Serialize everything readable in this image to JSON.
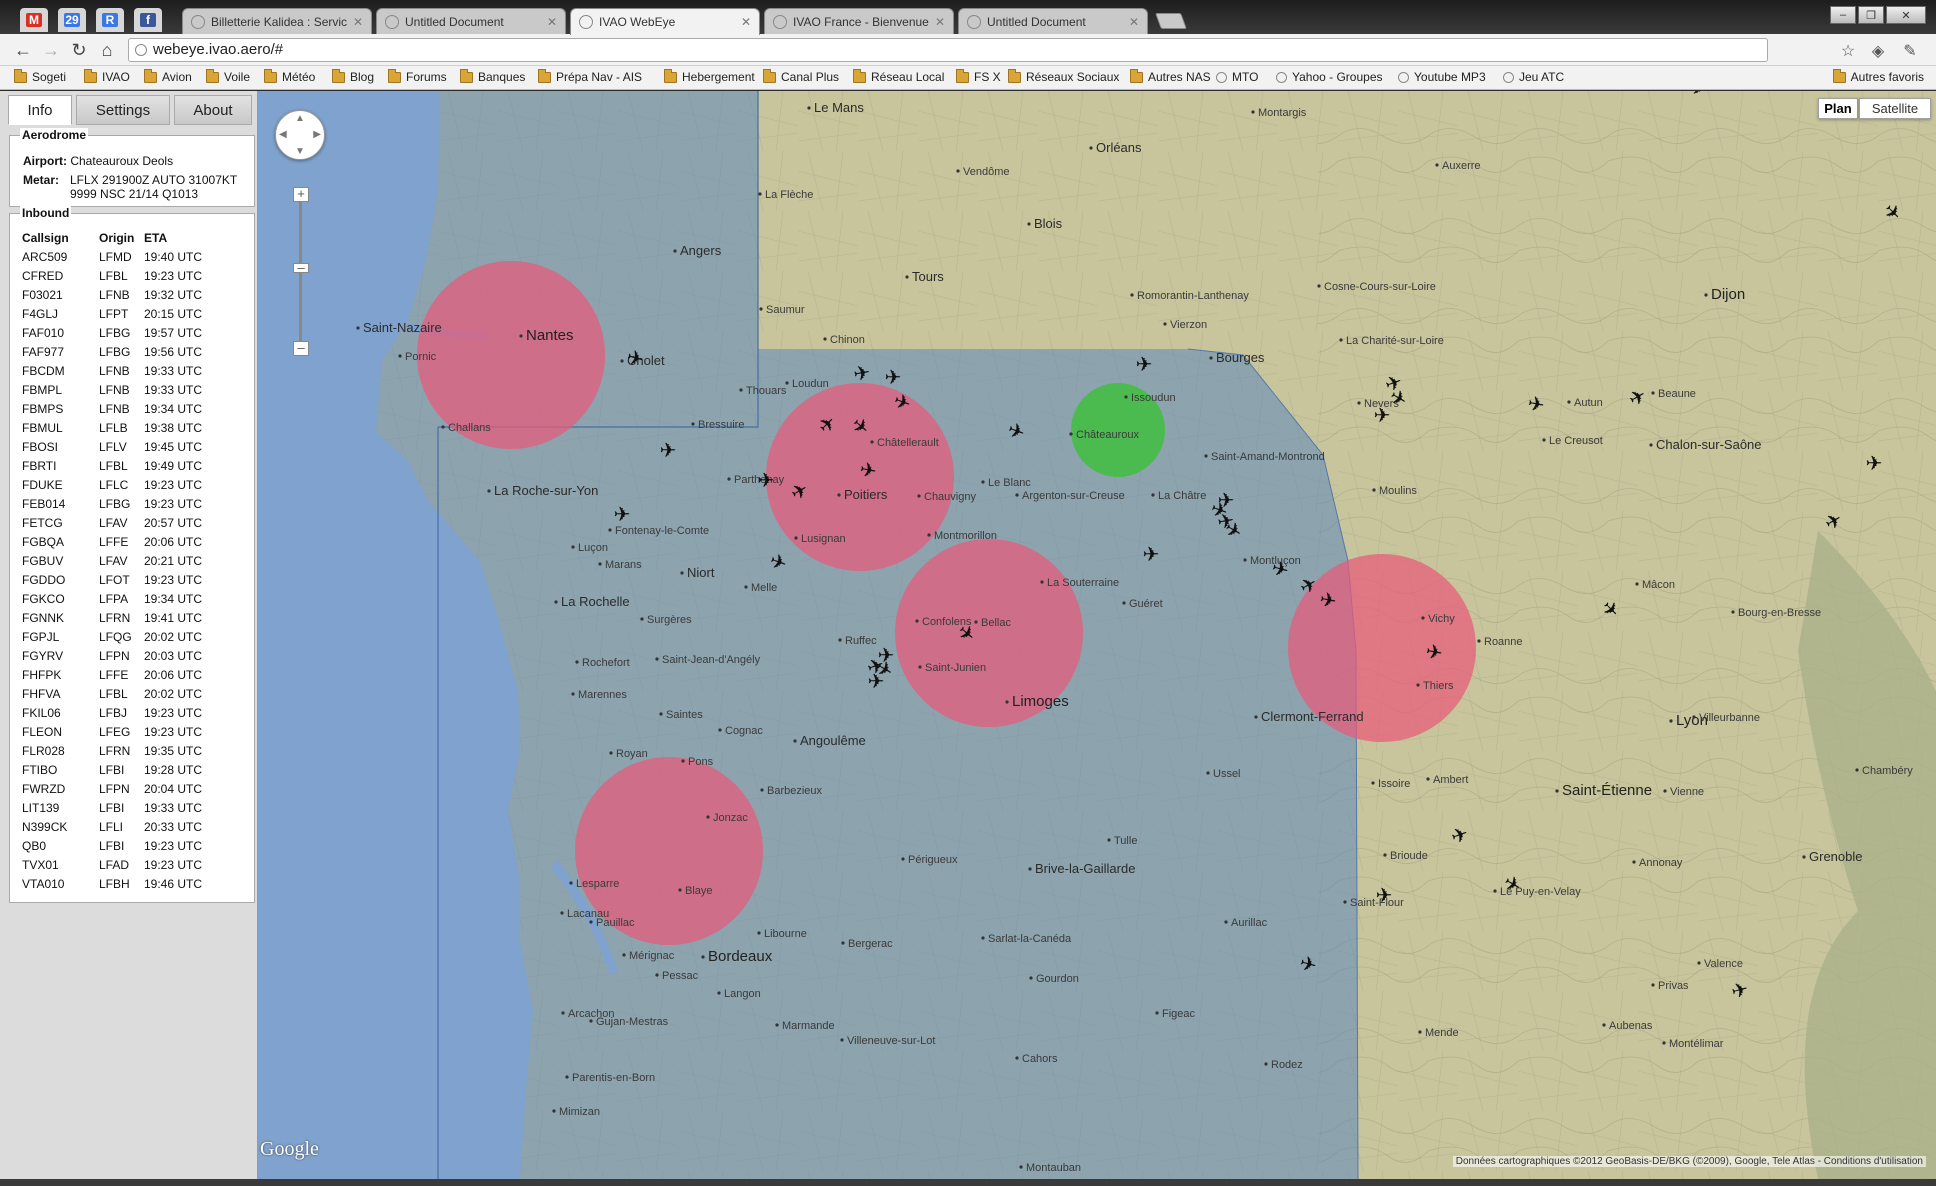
{
  "browser": {
    "pinned": [
      {
        "name": "gmail-icon",
        "label": "M",
        "color": "#d93025"
      },
      {
        "name": "calendar-icon",
        "label": "29",
        "color": "#3b78e7"
      },
      {
        "name": "reader-icon",
        "label": "R",
        "color": "#3b78e7"
      },
      {
        "name": "facebook-icon",
        "label": "f",
        "color": "#3b5998"
      }
    ],
    "tabs": [
      {
        "title": "Billetterie Kalidea : Services",
        "active": false
      },
      {
        "title": "Untitled Document",
        "active": false
      },
      {
        "title": "IVAO WebEye",
        "active": true
      },
      {
        "title": "IVAO France - Bienvenue /",
        "active": false
      },
      {
        "title": "Untitled Document",
        "active": false
      }
    ],
    "url": "webeye.ivao.aero/#",
    "bookmarks": [
      {
        "label": "Sogeti",
        "kind": "folder"
      },
      {
        "label": "IVAO",
        "kind": "folder"
      },
      {
        "label": "Avion",
        "kind": "folder"
      },
      {
        "label": "Voile",
        "kind": "folder"
      },
      {
        "label": "Météo",
        "kind": "folder"
      },
      {
        "label": "Blog",
        "kind": "folder"
      },
      {
        "label": "Forums",
        "kind": "folder"
      },
      {
        "label": "Banques",
        "kind": "folder"
      },
      {
        "label": "Prépa Nav - AIS",
        "kind": "folder"
      },
      {
        "label": "Hebergement",
        "kind": "folder"
      },
      {
        "label": "Canal Plus",
        "kind": "folder"
      },
      {
        "label": "Réseau Local",
        "kind": "folder"
      },
      {
        "label": "FS X",
        "kind": "folder"
      },
      {
        "label": "Réseaux Sociaux",
        "kind": "folder"
      },
      {
        "label": "Autres NAS",
        "kind": "folder"
      },
      {
        "label": "MTO",
        "kind": "page"
      },
      {
        "label": "Yahoo - Groupes",
        "kind": "page"
      },
      {
        "label": "Youtube MP3",
        "kind": "page"
      },
      {
        "label": "Jeu ATC",
        "kind": "page"
      }
    ],
    "other_bookmarks": "Autres favoris"
  },
  "panel": {
    "tabs": [
      "Info",
      "Settings",
      "About"
    ],
    "active_tab": "Info",
    "aerodrome": {
      "legend": "Aerodrome",
      "airport_label": "Airport:",
      "airport_value": "Chateauroux Deols",
      "metar_label": "Metar:",
      "metar_line1": "LFLX 291900Z AUTO 31007KT",
      "metar_line2": "9999 NSC 21/14 Q1013"
    },
    "inbound": {
      "legend": "Inbound",
      "columns": [
        "Callsign",
        "Origin",
        "ETA"
      ],
      "rows": [
        [
          "ARC509",
          "LFMD",
          "19:40 UTC"
        ],
        [
          "CFRED",
          "LFBL",
          "19:23 UTC"
        ],
        [
          "F03021",
          "LFNB",
          "19:32 UTC"
        ],
        [
          "F4GLJ",
          "LFPT",
          "20:15 UTC"
        ],
        [
          "FAF010",
          "LFBG",
          "19:57 UTC"
        ],
        [
          "FAF977",
          "LFBG",
          "19:56 UTC"
        ],
        [
          "FBCDM",
          "LFNB",
          "19:33 UTC"
        ],
        [
          "FBMPL",
          "LFNB",
          "19:33 UTC"
        ],
        [
          "FBMPS",
          "LFNB",
          "19:34 UTC"
        ],
        [
          "FBMUL",
          "LFLB",
          "19:38 UTC"
        ],
        [
          "FBOSI",
          "LFLV",
          "19:45 UTC"
        ],
        [
          "FBRTI",
          "LFBL",
          "19:49 UTC"
        ],
        [
          "FDUKE",
          "LFLC",
          "19:23 UTC"
        ],
        [
          "FEB014",
          "LFBG",
          "19:23 UTC"
        ],
        [
          "FETCG",
          "LFAV",
          "20:57 UTC"
        ],
        [
          "FGBQA",
          "LFFE",
          "20:06 UTC"
        ],
        [
          "FGBUV",
          "LFAV",
          "20:21 UTC"
        ],
        [
          "FGDDO",
          "LFOT",
          "19:23 UTC"
        ],
        [
          "FGKCO",
          "LFPA",
          "19:34 UTC"
        ],
        [
          "FGNNK",
          "LFRN",
          "19:41 UTC"
        ],
        [
          "FGPJL",
          "LFQG",
          "20:02 UTC"
        ],
        [
          "FGYRV",
          "LFPN",
          "20:03 UTC"
        ],
        [
          "FHFPK",
          "LFFE",
          "20:06 UTC"
        ],
        [
          "FHFVA",
          "LFBL",
          "20:02 UTC"
        ],
        [
          "FKIL06",
          "LFBJ",
          "19:23 UTC"
        ],
        [
          "FLEON",
          "LFEG",
          "19:23 UTC"
        ],
        [
          "FLR028",
          "LFRN",
          "19:35 UTC"
        ],
        [
          "FTIBO",
          "LFBI",
          "19:28 UTC"
        ],
        [
          "FWRZD",
          "LFPN",
          "20:04 UTC"
        ],
        [
          "LIT139",
          "LFBI",
          "19:33 UTC"
        ],
        [
          "N399CK",
          "LFLI",
          "20:33 UTC"
        ],
        [
          "QB0",
          "LFBI",
          "19:23 UTC"
        ],
        [
          "TVX01",
          "LFAD",
          "19:23 UTC"
        ],
        [
          "VTA010",
          "LFBH",
          "19:46 UTC"
        ]
      ]
    }
  },
  "map": {
    "maptypes": [
      "Plan",
      "Satellite"
    ],
    "active_maptype": "Plan",
    "google_logo": "Google",
    "copyright": "Données cartographiques ©2012 GeoBasis-DE/BKG (©2009), Google, Tele Atlas - Conditions d'utilisation",
    "colors": {
      "sector_fill": "#5d86bc",
      "circle_fill": "#e85a7a",
      "selected_fill": "#3fbf3f",
      "aircraft": "#111111"
    },
    "selected_airport": "Chateauroux",
    "approach_circles": [
      "Nantes",
      "Poitiers",
      "Limoges",
      "Clermont-Ferrand",
      "Bordeaux"
    ],
    "cities": [
      "Le Mans",
      "Orléans",
      "Angers",
      "Tours",
      "Blois",
      "Nantes",
      "Cholet",
      "Saint-Nazaire",
      "Poitiers",
      "Niort",
      "La Rochelle",
      "La Roche-sur-Yon",
      "Châteauroux",
      "Bourges",
      "Nevers",
      "Limoges",
      "Angoulême",
      "Clermont-Ferrand",
      "Vichy",
      "Montluçon",
      "Bordeaux",
      "Périgueux",
      "Brive-la-Gaillarde",
      "Tulle",
      "Aurillac",
      "Cahors",
      "Saint-Étienne",
      "Lyon",
      "Roanne",
      "Mâcon",
      "Grenoble",
      "Valence",
      "Dijon",
      "Villeurbanne",
      "Chambéry",
      "Moulins",
      "Guéret",
      "Rochefort",
      "Saintes",
      "Cognac",
      "Arcachon",
      "Libourne",
      "Bergerac",
      "Rodez",
      "Le Puy-en-Velay",
      "Montauban",
      "Mende",
      "Vierzon",
      "Issoudun",
      "Châtellerault",
      "Parthenay",
      "Thouars",
      "Saumur",
      "La Flèche",
      "Vendôme",
      "Romorantin-Lanthenay",
      "Montargis",
      "Auxerre",
      "Autun",
      "Beaune",
      "Chalon-sur-Saône",
      "Le Creusot",
      "Cosne-Cours-sur-Loire",
      "La Charité-sur-Loire",
      "Saint-Amand-Montrond",
      "La Châtre",
      "Le Blanc",
      "Argenton-sur-Creuse",
      "La Souterraine",
      "Bellac",
      "Saint-Junien",
      "Ussel",
      "Issoire",
      "Thiers",
      "Ambert",
      "Brioude",
      "Saint-Flour",
      "Figeac",
      "Sarlat-la-Canéda",
      "Gourdon",
      "Villeneuve-sur-Lot",
      "Marmande",
      "Langon",
      "Vienne",
      "Annonay",
      "Montélimar",
      "Privas",
      "Aubenas",
      "Bourg-en-Bresse",
      "Chalon",
      "Chinon",
      "Loudun",
      "Bressuire",
      "Fontenay-le-Comte",
      "Challans",
      "Pornic",
      "Luçon",
      "Marans",
      "Surgères",
      "Royan",
      "Jonzac",
      "Barbezieux",
      "Ruffec",
      "Confolens",
      "Montmorillon",
      "Chauvigny",
      "Lusignan",
      "Melle",
      "Saint-Jean-d'Angély",
      "Marennes",
      "Pons",
      "Blaye",
      "Lesparre",
      "Pauillac",
      "Lacanau",
      "Mérignac",
      "Pessac",
      "Gujan-Mestras",
      "Mimizan",
      "Parentis-en-Born"
    ]
  }
}
